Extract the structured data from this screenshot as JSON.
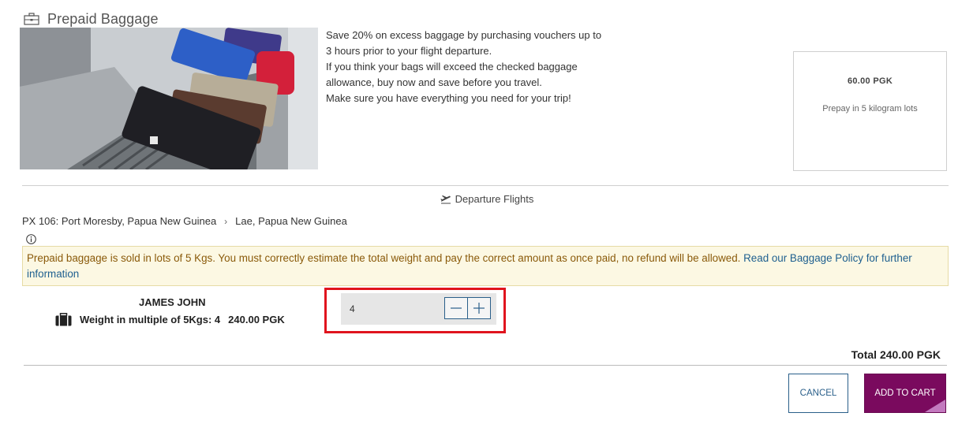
{
  "header": {
    "title": "Prepaid Baggage",
    "icon": "briefcase-icon"
  },
  "description": {
    "lines": [
      "Save 20% on excess baggage by purchasing vouchers up to",
      "3 hours prior to your flight departure.",
      "If you think your bags will exceed the checked baggage",
      "allowance, buy now and save before you travel.",
      "Make sure you have everything you need for your trip!"
    ]
  },
  "price_box": {
    "amount": "60.00  PGK",
    "note": "Prepay in 5 kilogram lots"
  },
  "departure": {
    "label": "Departure Flights",
    "flight": "PX 106: Port Moresby, Papua New Guinea",
    "destination": "Lae, Papua New Guinea"
  },
  "notice": {
    "text": "Prepaid baggage is sold in lots of 5 Kgs. You must correctly estimate the total weight and pay the correct amount as once paid, no refund will be allowed. ",
    "link": "Read our Baggage Policy for further information"
  },
  "passenger": {
    "name": "JAMES JOHN",
    "weight_label": "Weight in multiple of 5Kgs: 4",
    "amount": "240.00 PGK"
  },
  "stepper": {
    "value": "4"
  },
  "total": "Total 240.00 PGK",
  "actions": {
    "cancel": "CANCEL",
    "add_to_cart": "ADD TO CART"
  },
  "colors": {
    "accent": "#7a0a5e",
    "link": "#1e5f8f",
    "notice_bg": "#fcf8e3",
    "highlight": "#e0141e"
  }
}
